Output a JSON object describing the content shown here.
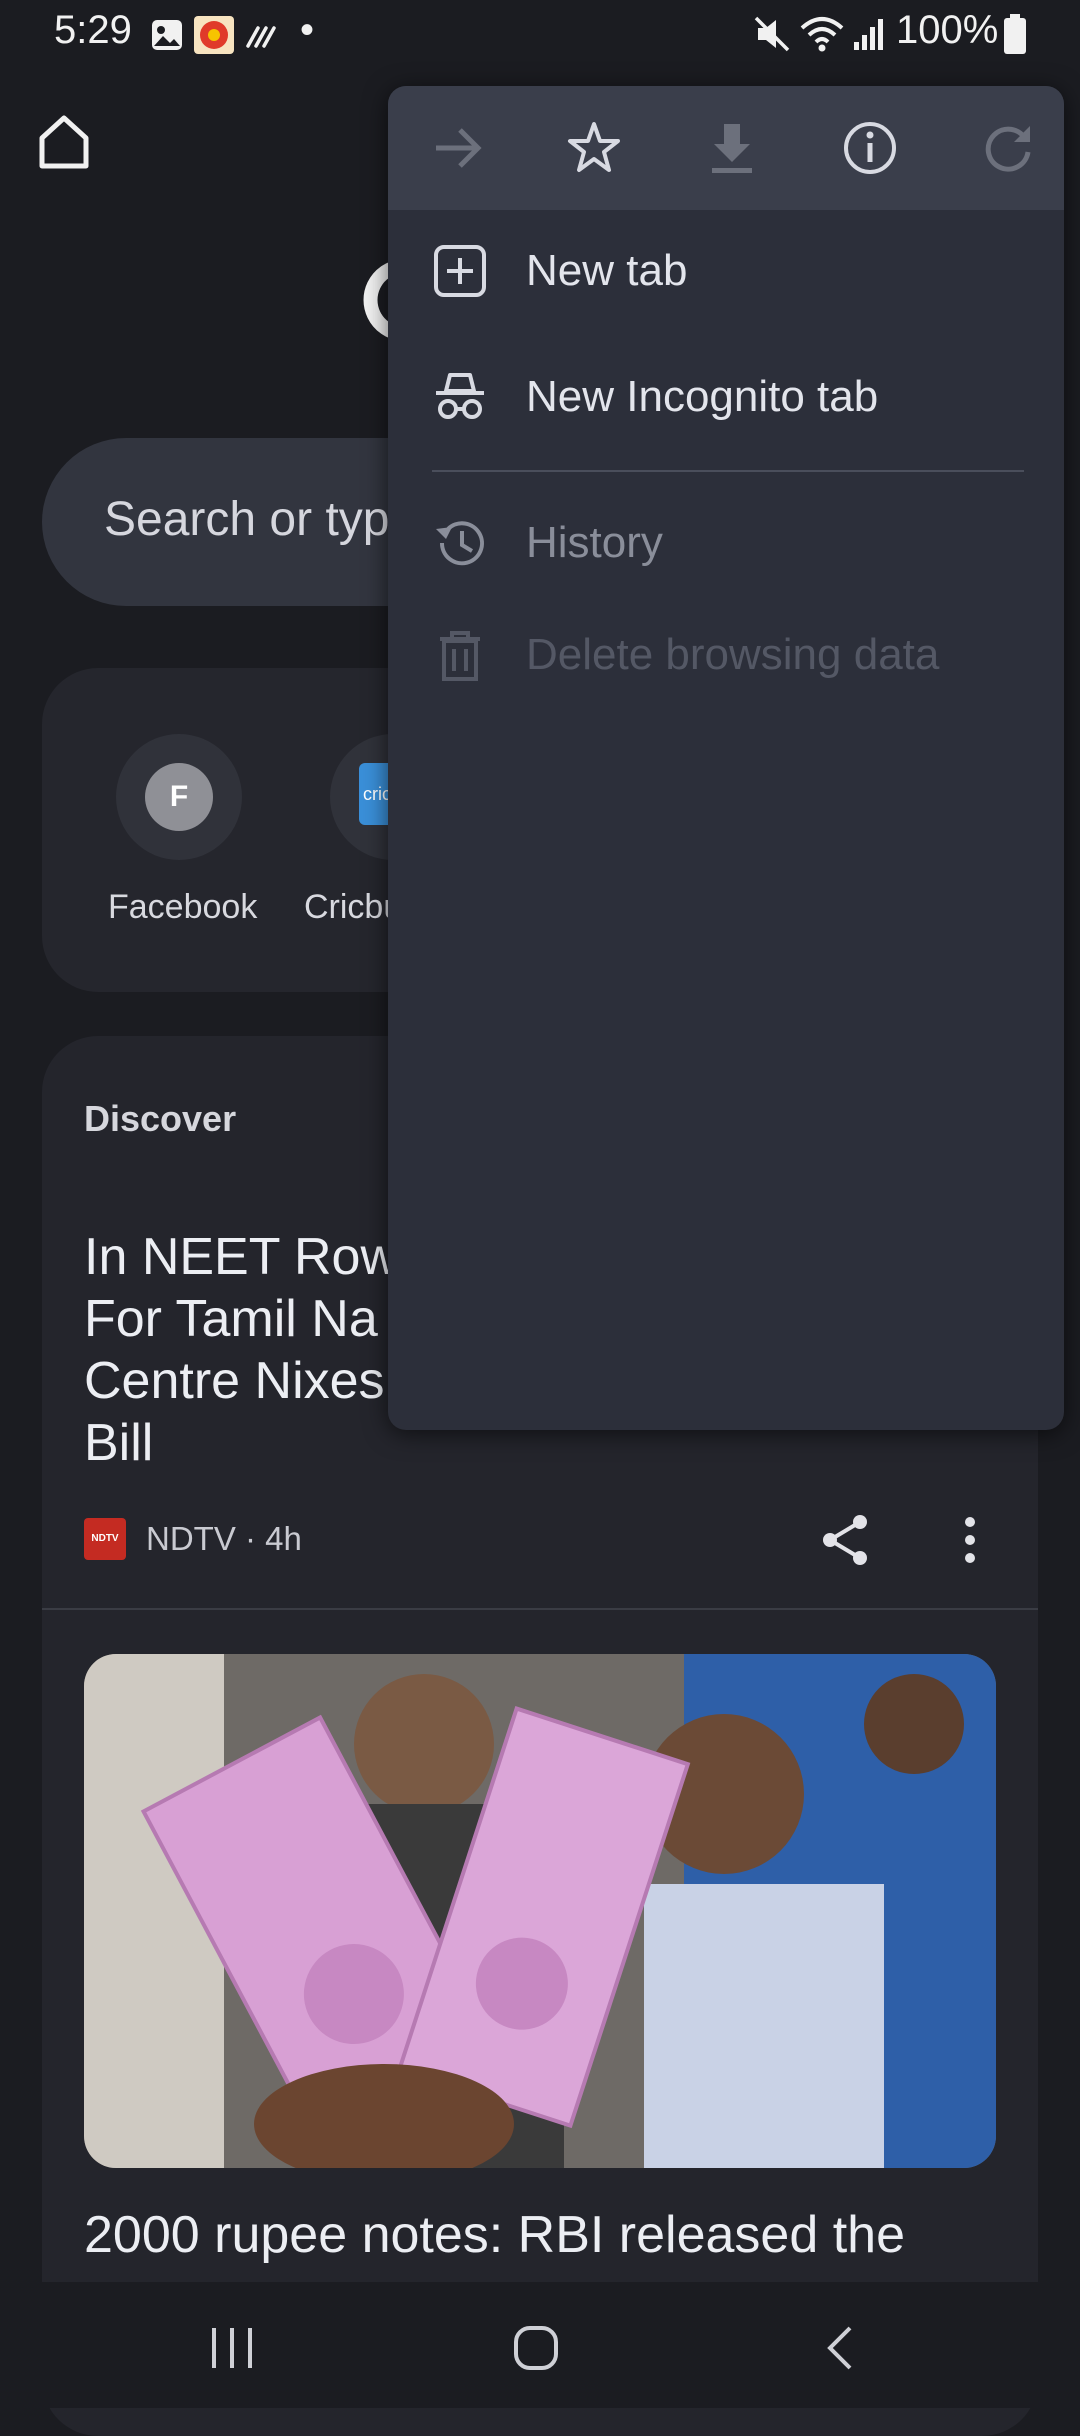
{
  "status_bar": {
    "time": "5:29",
    "battery": "100%",
    "dot": "•"
  },
  "shortcuts": [
    {
      "initial": "F",
      "label": "Facebook"
    },
    {
      "initial": "cric",
      "label": "Cricbu"
    }
  ],
  "search": {
    "placeholder": "Search or type"
  },
  "discover": {
    "label": "Discover",
    "article1": {
      "headline_lines": [
        "In NEET Row,",
        "For Tamil Na",
        "Centre Nixes",
        "Bill"
      ],
      "source": "NDTV · 4h",
      "logo_text": "NDTV"
    },
    "article2": {
      "headline": "2000 rupee notes: RBI released the"
    }
  },
  "menu": {
    "toolbar_icons": [
      "forward-arrow-icon",
      "star-icon",
      "download-icon",
      "info-icon",
      "refresh-icon"
    ],
    "items": [
      {
        "label": "New tab",
        "icon": "plus-box-icon",
        "enabled": true
      },
      {
        "label": "New Incognito tab",
        "icon": "incognito-icon",
        "enabled": true
      },
      {
        "label": "History",
        "icon": "history-icon",
        "enabled": false
      },
      {
        "label": "Delete browsing data",
        "icon": "trash-icon",
        "enabled": false
      }
    ]
  },
  "colors": {
    "background": "#1b1c21",
    "menu_bg": "#2c2f3a",
    "menu_toolbar_bg": "#3a3e4b",
    "disabled_text": "#5b5f6b"
  }
}
